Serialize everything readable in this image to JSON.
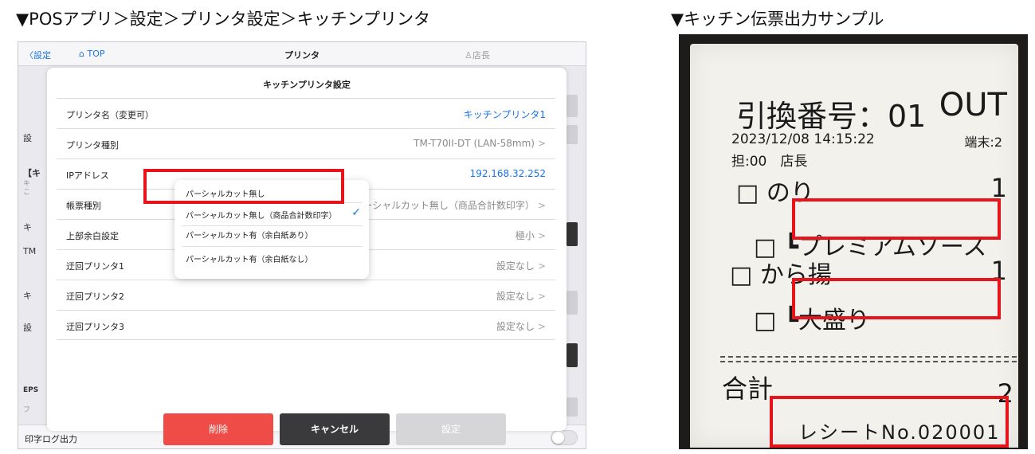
{
  "captions": {
    "left": "▼POSアプリ＞設定＞プリンタ設定＞キッチンプリンタ",
    "right": "▼キッチン伝票出力サンプル"
  },
  "navbar": {
    "back_label": "〈設定",
    "home_label": "TOP",
    "title": "プリンタ",
    "user_label": "店長"
  },
  "background": {
    "left_fragments": [
      "設",
      "【キ",
      "キ",
      "こ",
      "キ",
      "TM",
      "キ",
      "設",
      "EPS",
      "フ"
    ],
    "bottom_label": "印字ログ出力"
  },
  "modal": {
    "title": "キッチンプリンタ設定",
    "rows": [
      {
        "label": "プリンタ名（変更可）",
        "value": "キッチンプリンタ1"
      },
      {
        "label": "プリンタ種別",
        "value": "TM-T70II-DT (LAN-58mm)"
      },
      {
        "label": "IPアドレス",
        "value": "192.168.32.252"
      },
      {
        "label": "帳票種別",
        "value": "パーシャルカット無し（商品合計数印字）"
      },
      {
        "label": "上部余白設定",
        "value": "極小"
      },
      {
        "label": "迂回プリンタ1",
        "value": "設定なし"
      },
      {
        "label": "迂回プリンタ2",
        "value": "設定なし"
      },
      {
        "label": "迂回プリンタ3",
        "value": "設定なし"
      }
    ],
    "chevron": ">",
    "popover_options": [
      "パーシャルカット無し",
      "パーシャルカット無し（商品合計数印字）",
      "パーシャルカット有（余白紙あり）",
      "パーシャルカット有（余白紙なし）"
    ],
    "selected_mark": "✓",
    "buttons": {
      "delete": "削除",
      "cancel": "キャンセル",
      "set": "設定"
    }
  },
  "receipt": {
    "order_number": "引換番号：01",
    "type": "OUT",
    "datetime": "2023/12/08 14:15:22",
    "terminal": "端末:2",
    "staff": "担:00　店長",
    "items": [
      {
        "name": "□ のり",
        "qty": "1"
      },
      {
        "name": "□ ┗プレミアムソース",
        "qty": ""
      },
      {
        "name": "□ から揚",
        "qty": "1"
      },
      {
        "name": "□ ┗大盛り",
        "qty": ""
      }
    ],
    "total_label": "合計",
    "total_qty": "2",
    "receipt_no": "レシートNo.020001"
  }
}
